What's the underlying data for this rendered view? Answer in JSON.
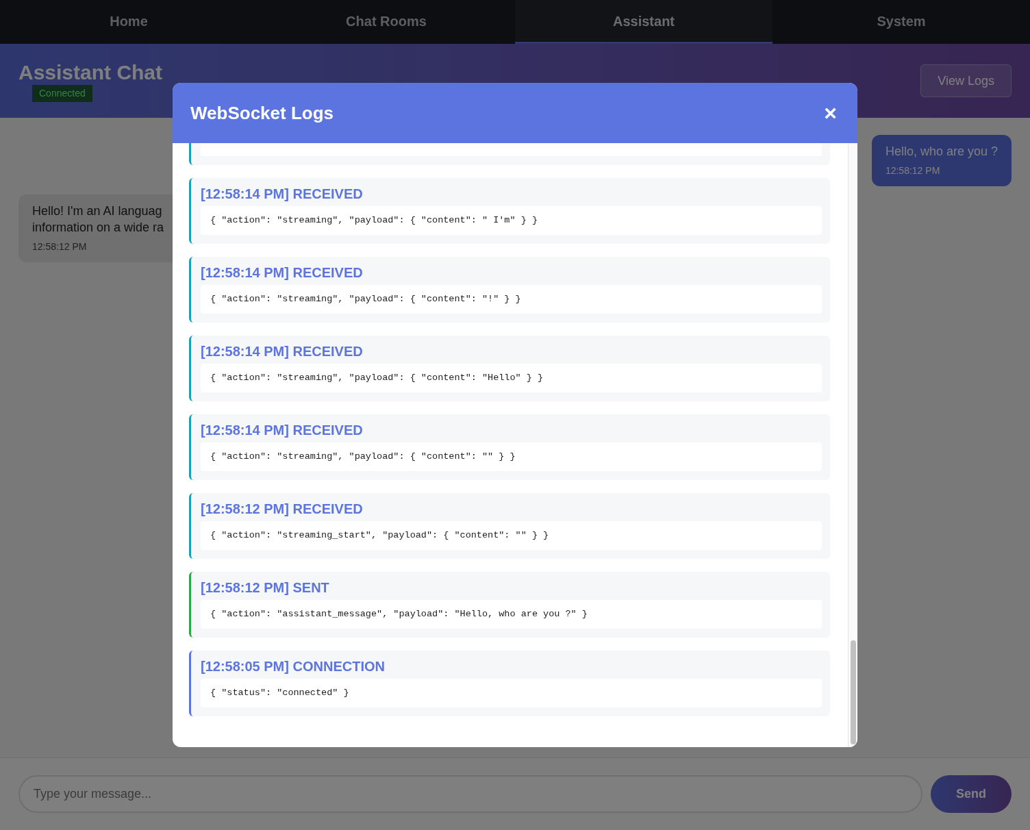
{
  "nav": {
    "tabs": [
      {
        "label": "Home",
        "selected": false
      },
      {
        "label": "Chat Rooms",
        "selected": false
      },
      {
        "label": "Assistant",
        "selected": true
      },
      {
        "label": "System",
        "selected": false
      }
    ]
  },
  "header": {
    "title": "Assistant Chat",
    "status": "Connected",
    "logs_button": "View Logs"
  },
  "messages": [
    {
      "kind": "user",
      "lines": [
        "Hello, who are you ?"
      ],
      "time": "12:58:12 PM"
    },
    {
      "kind": "assistant",
      "lines": [
        "Hello! I'm an AI languag",
        "information on a wide ra"
      ],
      "time": "12:58:12 PM"
    }
  ],
  "composer": {
    "placeholder": "Type your message...",
    "send_button": "Send"
  },
  "modal": {
    "title": "WebSocket Logs",
    "close": "×",
    "entries": [
      {
        "kind": "received"
      },
      {
        "kind": "received",
        "heading": "[12:58:14 PM] RECEIVED",
        "code": "{ \"action\": \"streaming\", \"payload\": { \"content\": \" I'm\" } }"
      },
      {
        "kind": "received",
        "heading": "[12:58:14 PM] RECEIVED",
        "code": "{ \"action\": \"streaming\", \"payload\": { \"content\": \"!\" } }"
      },
      {
        "kind": "received",
        "heading": "[12:58:14 PM] RECEIVED",
        "code": "{ \"action\": \"streaming\", \"payload\": { \"content\": \"Hello\" } }"
      },
      {
        "kind": "received",
        "heading": "[12:58:14 PM] RECEIVED",
        "code": "{ \"action\": \"streaming\", \"payload\": { \"content\": \"\" } }"
      },
      {
        "kind": "received",
        "heading": "[12:58:12 PM] RECEIVED",
        "code": "{ \"action\": \"streaming_start\", \"payload\": { \"content\": \"\" } }"
      },
      {
        "kind": "sent",
        "heading": "[12:58:12 PM] SENT",
        "code": "{ \"action\": \"assistant_message\", \"payload\": \"Hello, who are you ?\" }"
      },
      {
        "kind": "connection",
        "heading": "[12:58:05 PM] CONNECTION",
        "code": "{ \"status\": \"connected\" }"
      }
    ]
  }
}
